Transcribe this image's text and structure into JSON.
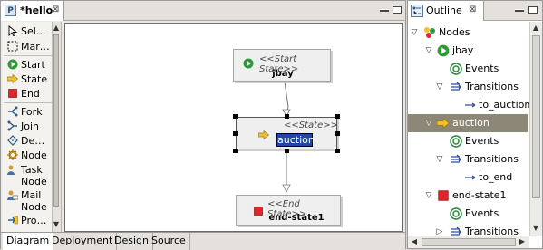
{
  "editor": {
    "tab_title": "*hello",
    "tab_icon": "P",
    "palette": [
      {
        "label": "Sel…",
        "icon": "select-arrow-icon"
      },
      {
        "label": "Mar…",
        "icon": "marquee-icon"
      },
      {
        "label": "Start",
        "icon": "start-state-icon"
      },
      {
        "label": "State",
        "icon": "state-icon"
      },
      {
        "label": "End",
        "icon": "end-state-icon"
      },
      {
        "label": "Fork",
        "icon": "fork-icon"
      },
      {
        "label": "Join",
        "icon": "join-icon"
      },
      {
        "label": "De…",
        "icon": "decision-icon"
      },
      {
        "label": "Node",
        "icon": "node-icon"
      },
      {
        "label": "Task",
        "label2": "Node",
        "icon": "task-node-icon"
      },
      {
        "label": "Mail",
        "label2": "Node",
        "icon": "mail-node-icon"
      },
      {
        "label": "Pro…",
        "icon": "process-state-icon"
      }
    ],
    "nodes": {
      "start": {
        "stereotype": "<<Start State>>",
        "name": "jbay"
      },
      "state": {
        "stereotype": "<<State>>",
        "name": "auction"
      },
      "end": {
        "stereotype": "<<End State>>",
        "name": "end-state1"
      }
    },
    "bottom_tabs": [
      "Diagram",
      "Deployment",
      "Design",
      "Source"
    ],
    "active_bottom_tab": "Diagram"
  },
  "outline": {
    "title": "Outline",
    "tree": [
      {
        "label": "Nodes",
        "icon": "nodes-icon",
        "expanded": true
      },
      {
        "label": "jbay",
        "icon": "start-state-icon",
        "expanded": true
      },
      {
        "label": "Events",
        "icon": "events-icon"
      },
      {
        "label": "Transitions",
        "icon": "transitions-icon",
        "expanded": true
      },
      {
        "label": "to_auction",
        "icon": "transition-arrow-icon"
      },
      {
        "label": "auction",
        "icon": "state-icon",
        "expanded": true,
        "selected": true
      },
      {
        "label": "Events",
        "icon": "events-icon"
      },
      {
        "label": "Transitions",
        "icon": "transitions-icon",
        "expanded": true
      },
      {
        "label": "to_end",
        "icon": "transition-arrow-icon"
      },
      {
        "label": "end-state1",
        "icon": "end-state-icon",
        "expanded": true
      },
      {
        "label": "Events",
        "icon": "events-icon"
      },
      {
        "label": "Transitions",
        "icon": "transitions-icon"
      }
    ]
  }
}
